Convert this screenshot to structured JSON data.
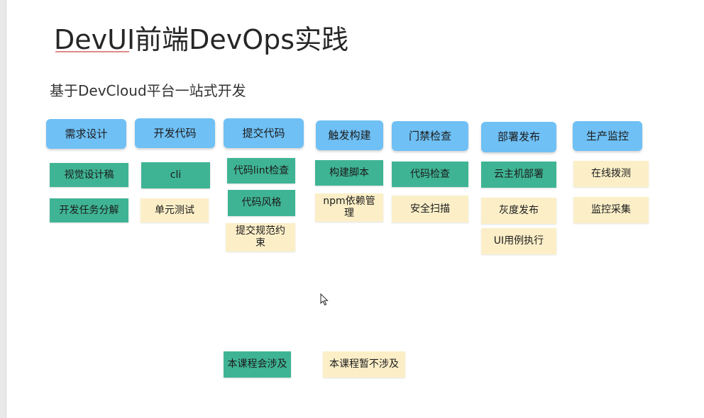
{
  "title": "DevUI前端DevOps实践",
  "subtitle": "基于DevCloud平台一站式开发",
  "colors": {
    "header": "#6fc0f5",
    "covered": "#3fb494",
    "not_covered": "#fcefc8"
  },
  "columns": [
    {
      "header": "需求设计",
      "items": [
        {
          "label": "视觉设计稿",
          "status": "covered"
        },
        {
          "label": "开发任务分解",
          "status": "covered"
        }
      ]
    },
    {
      "header": "开发代码",
      "items": [
        {
          "label": "cli",
          "status": "covered"
        },
        {
          "label": "单元测试",
          "status": "not_covered"
        }
      ]
    },
    {
      "header": "提交代码",
      "items": [
        {
          "label": "代码lint检查",
          "status": "covered"
        },
        {
          "label": "代码风格",
          "status": "covered"
        },
        {
          "label": "提交规范约束",
          "status": "not_covered"
        }
      ]
    },
    {
      "header": "触发构建",
      "items": [
        {
          "label": "构建脚本",
          "status": "covered"
        },
        {
          "label": "npm依赖管理",
          "status": "not_covered"
        }
      ]
    },
    {
      "header": "门禁检查",
      "items": [
        {
          "label": "代码检查",
          "status": "covered"
        },
        {
          "label": "安全扫描",
          "status": "not_covered"
        }
      ]
    },
    {
      "header": "部署发布",
      "items": [
        {
          "label": "云主机部署",
          "status": "covered"
        },
        {
          "label": "灰度发布",
          "status": "not_covered"
        },
        {
          "label": "UI用例执行",
          "status": "not_covered"
        }
      ]
    },
    {
      "header": "生产监控",
      "items": [
        {
          "label": "在线拨测",
          "status": "not_covered"
        },
        {
          "label": "监控采集",
          "status": "not_covered"
        }
      ]
    }
  ],
  "legend": [
    {
      "label": "本课程会涉及",
      "status": "covered"
    },
    {
      "label": "本课程暂不涉及",
      "status": "not_covered"
    }
  ]
}
